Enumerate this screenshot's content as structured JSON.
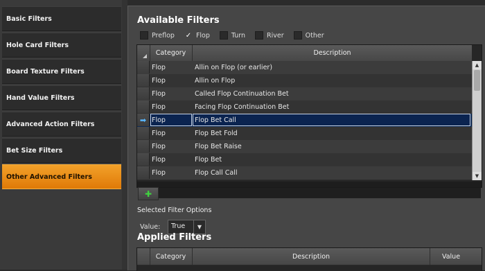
{
  "sidebar": {
    "items": [
      {
        "label": "Basic Filters"
      },
      {
        "label": "Hole Card Filters"
      },
      {
        "label": "Board Texture Filters"
      },
      {
        "label": "Hand Value Filters"
      },
      {
        "label": "Advanced Action Filters"
      },
      {
        "label": "Bet Size Filters"
      },
      {
        "label": "Other Advanced Filters"
      }
    ],
    "active_index": 6,
    "active_color": "#e88a12"
  },
  "available": {
    "title": "Available Filters",
    "streets": [
      {
        "label": "Preflop",
        "checked": false
      },
      {
        "label": "Flop",
        "checked": true
      },
      {
        "label": "Turn",
        "checked": false
      },
      {
        "label": "River",
        "checked": false
      },
      {
        "label": "Other",
        "checked": false
      }
    ],
    "columns": {
      "category": "Category",
      "description": "Description"
    },
    "rows": [
      {
        "category": "Flop",
        "description": "Allin on Flop (or earlier)"
      },
      {
        "category": "Flop",
        "description": "Allin on Flop"
      },
      {
        "category": "Flop",
        "description": "Called Flop Continuation Bet"
      },
      {
        "category": "Flop",
        "description": "Facing Flop Continuation Bet"
      },
      {
        "category": "Flop",
        "description": "Flop Bet Call"
      },
      {
        "category": "Flop",
        "description": "Flop Bet Fold"
      },
      {
        "category": "Flop",
        "description": "Flop Bet Raise"
      },
      {
        "category": "Flop",
        "description": "Flop Bet"
      },
      {
        "category": "Flop",
        "description": "Flop Call Call"
      }
    ],
    "selected_index": 4,
    "add_button_icon": "add-icon"
  },
  "options": {
    "title": "Selected Filter Options",
    "value_label": "Value:",
    "value": "True"
  },
  "applied": {
    "title": "Applied Filters",
    "columns": {
      "category": "Category",
      "description": "Description",
      "value": "Value"
    }
  }
}
